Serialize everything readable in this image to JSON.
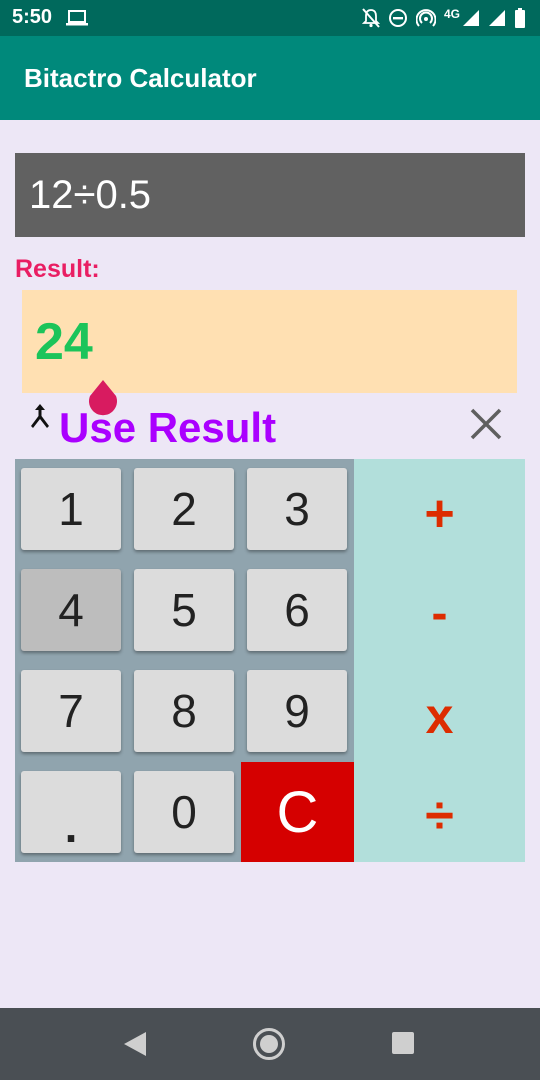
{
  "status_bar": {
    "time": "5:50",
    "network": "4G",
    "icons": [
      "laptop-icon",
      "notifications-off-icon",
      "do-not-disturb-icon",
      "hotspot-icon",
      "signal-icon",
      "signal-icon",
      "battery-icon"
    ]
  },
  "app_bar": {
    "title": "Bitactro Calculator"
  },
  "expression": {
    "text": "12÷0.5"
  },
  "result": {
    "label": "Result:",
    "value": "24"
  },
  "actions": {
    "use_result_label": "Use Result",
    "merge_icon": "merge-icon",
    "close_icon": "close-icon"
  },
  "keypad": {
    "keys": [
      {
        "label": "1",
        "name": "key-1"
      },
      {
        "label": "2",
        "name": "key-2"
      },
      {
        "label": "3",
        "name": "key-3"
      },
      {
        "label": "4",
        "name": "key-4",
        "pressed": true
      },
      {
        "label": "5",
        "name": "key-5"
      },
      {
        "label": "6",
        "name": "key-6"
      },
      {
        "label": "7",
        "name": "key-7"
      },
      {
        "label": "8",
        "name": "key-8"
      },
      {
        "label": "9",
        "name": "key-9"
      },
      {
        "label": ".",
        "name": "key-decimal"
      },
      {
        "label": "0",
        "name": "key-0"
      },
      {
        "label": "C",
        "name": "key-clear"
      }
    ],
    "operators": [
      {
        "label": "+",
        "name": "add-button"
      },
      {
        "label": "-",
        "name": "subtract-button"
      },
      {
        "label": "x",
        "name": "multiply-button"
      },
      {
        "label": "÷",
        "name": "divide-button"
      }
    ]
  },
  "colors": {
    "status_bar": "#00695c",
    "app_bar": "#00897b",
    "background": "#ede7f6",
    "expression_bg": "#616161",
    "result_label": "#e91e63",
    "result_bg": "#ffe0b2",
    "result_value": "#1cc45a",
    "use_result": "#aa00ff",
    "keypad_bg": "#90a4ae",
    "operators_bg": "#b2dfdb",
    "operator_text": "#dd2c00",
    "clear_bg": "#d50000"
  },
  "nav_bar": {
    "icons": [
      "back-icon",
      "home-icon",
      "recents-icon"
    ]
  }
}
